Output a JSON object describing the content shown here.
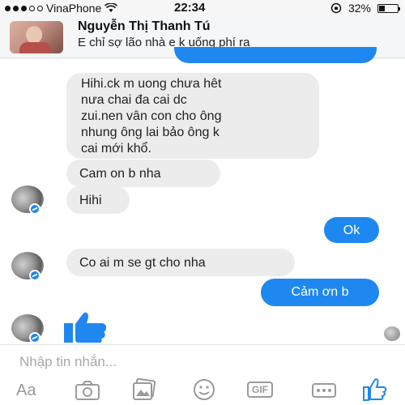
{
  "status_bar": {
    "carrier": "VinaPhone",
    "time": "22:34",
    "battery_percent": "32%",
    "battery_level": 0.32
  },
  "header": {
    "contact_name": "Nguyễn Thị Thanh Tú",
    "status_text": "E chỉ sợ lão nhà e k uống phí ra"
  },
  "messages": [
    {
      "direction": "in",
      "text": "Hihi.ck m uong chưa hêt\nnưa chai đa cai dc\nzui.nen vân con cho ông\nnhung ông lai bảo ông  k\ncai mới khổ."
    },
    {
      "direction": "in",
      "text": "Cam on b nha"
    },
    {
      "direction": "in",
      "text": "Hihi"
    },
    {
      "direction": "out",
      "text": "Ok"
    },
    {
      "direction": "in",
      "text": "Co ai m se gt cho nha"
    },
    {
      "direction": "out",
      "text": "Cảm ơn b"
    }
  ],
  "composer": {
    "placeholder": "Nhập tin nhắn...",
    "aa_label": "Aa",
    "gif_label": "GIF"
  },
  "colors": {
    "outgoing_bubble": "#1e88f0",
    "incoming_bubble": "#ececec",
    "like_icon": "#1e88f0"
  }
}
